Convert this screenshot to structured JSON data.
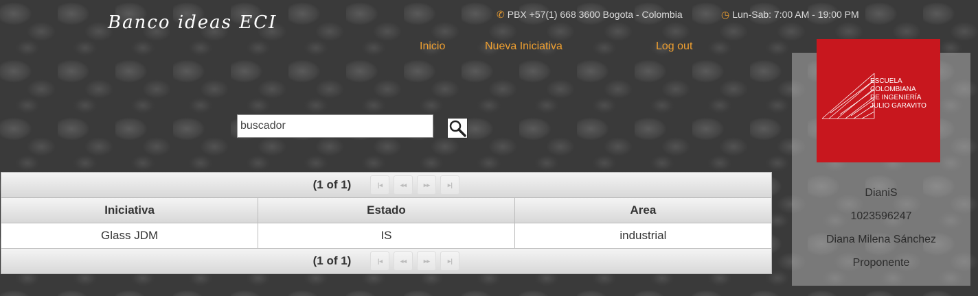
{
  "brand": "Banco ideas ECI",
  "contact": {
    "phone": "PBX +57(1) 668 3600 Bogota - Colombia",
    "hours": "Lun-Sab: 7:00 AM - 19:00 PM"
  },
  "nav": {
    "inicio": "Inicio",
    "nueva": "Nueva Iniciativa",
    "logout": "Log out"
  },
  "search": {
    "value": "buscador"
  },
  "table": {
    "pager_text": "(1 of 1)",
    "headers": [
      "Iniciativa",
      "Estado",
      "Area"
    ],
    "rows": [
      [
        "Glass JDM",
        "IS",
        "industrial"
      ]
    ]
  },
  "logo": {
    "line1": "ESCUELA",
    "line2": "COLOMBIANA",
    "line3": "DE INGENIERÍA",
    "line4": "JULIO GARAVITO"
  },
  "user": {
    "username": "DianiS",
    "id": "1023596247",
    "name": "Diana Milena Sánchez",
    "role": "Proponente"
  },
  "colors": {
    "accent": "#f0a030",
    "logo_red": "#c8171e"
  }
}
